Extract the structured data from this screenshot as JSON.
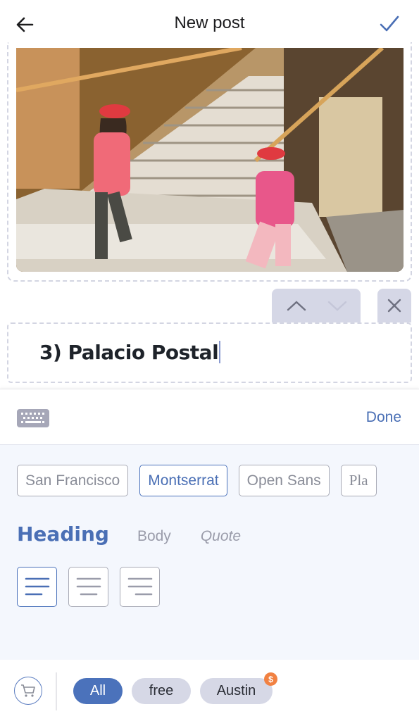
{
  "header": {
    "title": "New post",
    "back_icon": "arrow-left-icon",
    "confirm_icon": "checkmark-icon"
  },
  "image_block": {
    "description": "Two girls in red caps climbing an ornate golden staircase"
  },
  "block_controls": {
    "move_up_icon": "chevron-up-icon",
    "move_down_icon": "chevron-down-icon",
    "delete_icon": "close-icon"
  },
  "text_block": {
    "value": "3) Palacio Postal"
  },
  "toolbar": {
    "keyboard_icon": "keyboard-icon",
    "done_label": "Done"
  },
  "format_panel": {
    "fonts": [
      {
        "label": "San Francisco",
        "active": false
      },
      {
        "label": "Montserrat",
        "active": true
      },
      {
        "label": "Open Sans",
        "active": false
      },
      {
        "label": "Pla",
        "active": false
      }
    ],
    "styles": [
      {
        "label": "Heading",
        "active": true
      },
      {
        "label": "Body",
        "active": false
      },
      {
        "label": "Quote",
        "active": false
      }
    ],
    "alignments": [
      {
        "name": "align-left",
        "active": true
      },
      {
        "name": "align-center",
        "active": false
      },
      {
        "name": "align-right",
        "active": false
      }
    ]
  },
  "bottom_bar": {
    "cart_icon": "cart-icon",
    "filters": [
      {
        "label": "All",
        "active": true
      },
      {
        "label": "free",
        "active": false
      },
      {
        "label": "Austin",
        "active": false,
        "badge": "$"
      }
    ]
  },
  "colors": {
    "accent": "#4b72bb",
    "chip_bg": "#d6d8e6",
    "badge": "#f18142",
    "panel_bg": "#f4f7fd"
  }
}
